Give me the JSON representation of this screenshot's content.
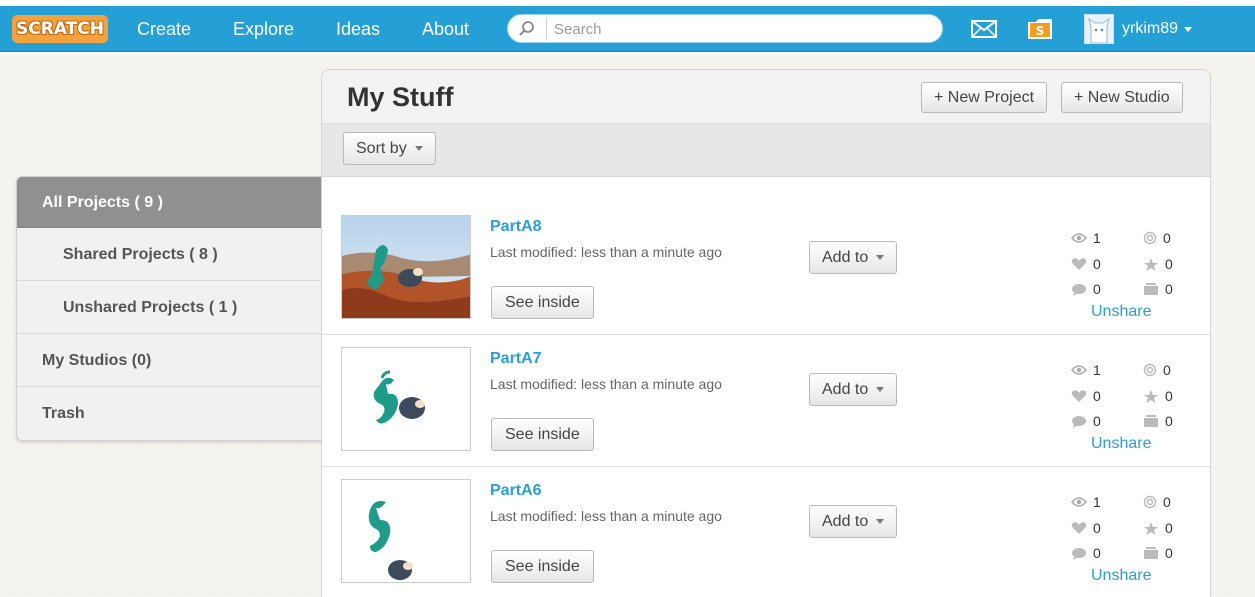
{
  "nav": {
    "logo": "SCRATCH",
    "links": [
      "Create",
      "Explore",
      "Ideas",
      "About"
    ],
    "search_placeholder": "Search",
    "username": "yrkim89"
  },
  "sidebar": {
    "items": [
      {
        "label": "All Projects ( 9 )"
      },
      {
        "label": "Shared Projects ( 8 )"
      },
      {
        "label": "Unshared Projects ( 1 )"
      },
      {
        "label": "My Studios (0)"
      },
      {
        "label": "Trash"
      }
    ]
  },
  "main": {
    "title": "My Stuff",
    "new_project": "+ New Project",
    "new_studio": "+ New Studio",
    "sort_by": "Sort by"
  },
  "projects": [
    {
      "title": "PartA8",
      "modified": "Last modified: less than a minute ago",
      "see_inside": "See inside",
      "add_to": "Add to",
      "views": "1",
      "remixes": "0",
      "loves": "0",
      "favorites": "0",
      "comments": "0",
      "studios": "0",
      "unshare": "Unshare"
    },
    {
      "title": "PartA7",
      "modified": "Last modified: less than a minute ago",
      "see_inside": "See inside",
      "add_to": "Add to",
      "views": "1",
      "remixes": "0",
      "loves": "0",
      "favorites": "0",
      "comments": "0",
      "studios": "0",
      "unshare": "Unshare"
    },
    {
      "title": "PartA6",
      "modified": "Last modified: less than a minute ago",
      "see_inside": "See inside",
      "add_to": "Add to",
      "views": "1",
      "remixes": "0",
      "loves": "0",
      "favorites": "0",
      "comments": "0",
      "studios": "0",
      "unshare": "Unshare"
    }
  ],
  "colors": {
    "nav_blue": "#25a0d7",
    "link_blue": "#2a9fd6",
    "active_sidebar": "#909090",
    "sprite_teal": "#1f9b8a"
  }
}
